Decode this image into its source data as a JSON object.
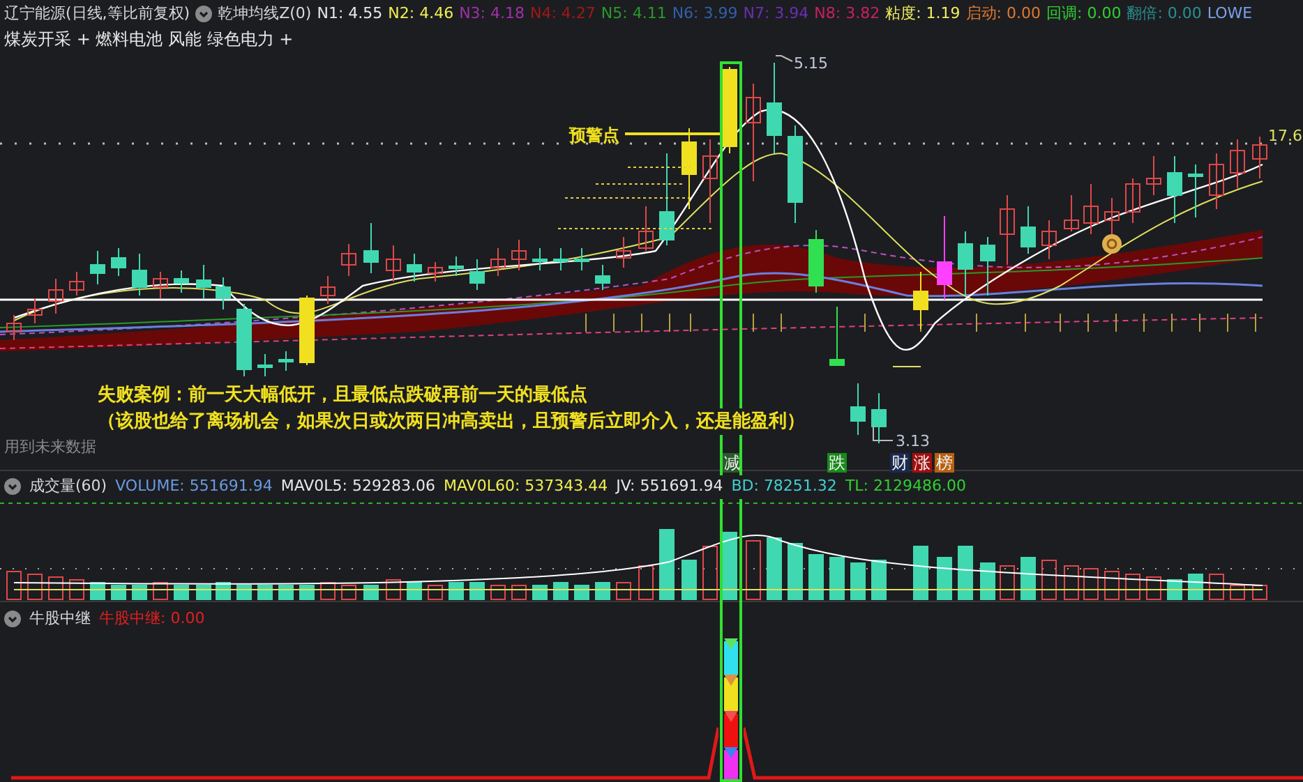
{
  "header": {
    "title": "辽宁能源(日线,等比前复权)",
    "indicator": "乾坤均线Z(0)",
    "values": [
      {
        "text": "N1: 4.55",
        "color": "#e8e8e8"
      },
      {
        "text": "N2: 4.46",
        "color": "#f0f050"
      },
      {
        "text": "N3: 4.18",
        "color": "#a030a8"
      },
      {
        "text": "N4: 4.27",
        "color": "#a01818"
      },
      {
        "text": "N5: 4.11",
        "color": "#2a9a2a"
      },
      {
        "text": "N6: 3.99",
        "color": "#3060a8"
      },
      {
        "text": "N7: 3.94",
        "color": "#6a30b0"
      },
      {
        "text": "N8: 3.82",
        "color": "#c82060"
      },
      {
        "text": "粘度: 1.19",
        "color": "#f0f060"
      },
      {
        "text": "启动: 0.00",
        "color": "#e07830"
      },
      {
        "text": "回调: 0.00",
        "color": "#30d030"
      },
      {
        "text": "翻倍: 0.00",
        "color": "#2a9090"
      },
      {
        "text": "LOWE",
        "color": "#7aa0e8"
      }
    ],
    "sectors": "煤炭开采 + 燃料电池 风能 绿色电力 +"
  },
  "chart": {
    "warning_label": "预警点",
    "high_label": "5.15",
    "last_label": "17.6",
    "low_label": "3.13",
    "note_lines": [
      "失败案例：前一天大幅低开，且最低点跌破再前一天的最低点",
      "（该股也给了离场机会，如果次日或次两日冲高卖出，且预警后立即介入，还是能盈利）"
    ],
    "footnote": "用到未来数据",
    "markers": [
      {
        "text": "减",
        "color": "#2a5a2a"
      },
      {
        "text": "跌",
        "color": "#1a8a1a"
      },
      {
        "text": "财",
        "color": "#1a2a50"
      },
      {
        "text": "涨",
        "color": "#a01010"
      },
      {
        "text": "榜",
        "color": "#b86010"
      }
    ]
  },
  "volume": {
    "title": "成交量(60)",
    "values": [
      {
        "text": "VOLUME: 551691.94",
        "color": "#6a9ae0"
      },
      {
        "text": "MAV0L5: 529283.06",
        "color": "#e8e8e8"
      },
      {
        "text": "MAV0L60: 537343.44",
        "color": "#f0f050"
      },
      {
        "text": "JV: 551691.94",
        "color": "#e8e8e8"
      },
      {
        "text": "BD: 78251.32",
        "color": "#40d0d0"
      },
      {
        "text": "TL: 2129486.00",
        "color": "#30d030"
      }
    ]
  },
  "relay": {
    "title": "牛股中继",
    "values": [
      {
        "text": "牛股中继: 0.00",
        "color": "#e02020"
      }
    ]
  }
}
